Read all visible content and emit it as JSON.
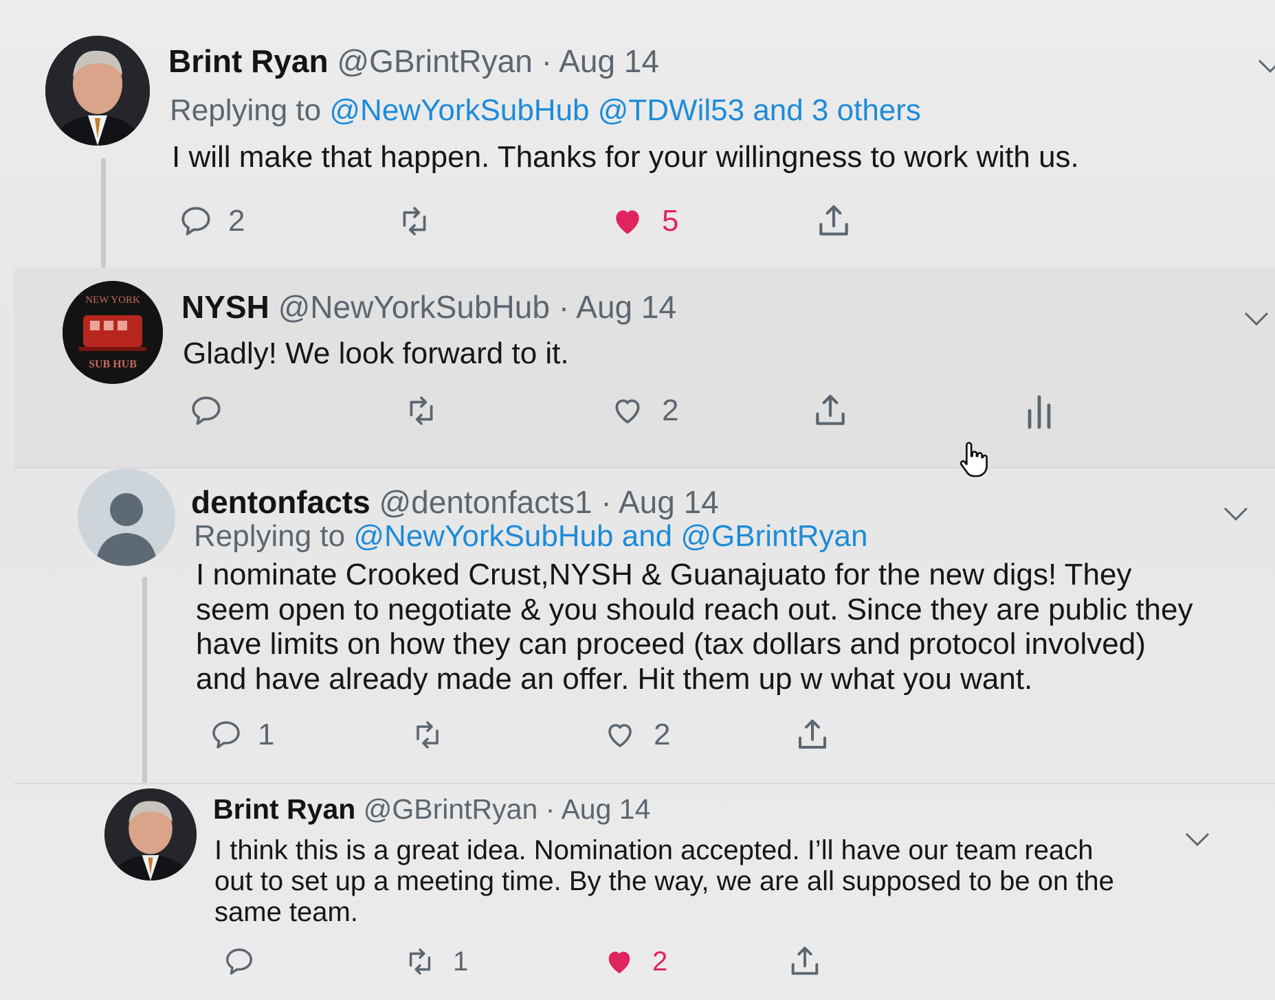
{
  "colors": {
    "link": "#1d8bd8",
    "muted": "#5b6670",
    "like_active": "#e0245e"
  },
  "tweets": [
    {
      "name": "Brint Ryan",
      "handle": "@GBrintRyan",
      "separator": "·",
      "date": "Aug 14",
      "reply_prefix": "Replying to",
      "reply_links": [
        "@NewYorkSubHub",
        "@TDWil53",
        "and 3 others"
      ],
      "text": "I will make that happen.  Thanks for your willingness to work with us.",
      "replies": "2",
      "retweets": "",
      "likes": "5",
      "liked": true
    },
    {
      "name": "NYSH",
      "handle": "@NewYorkSubHub",
      "separator": "·",
      "date": "Aug 14",
      "text": "Gladly! We look forward to it.",
      "replies": "",
      "retweets": "",
      "likes": "2",
      "liked": false,
      "avatar_text_top": "NEW YORK",
      "avatar_text_bottom": "SUB HUB"
    },
    {
      "name": "dentonfacts",
      "handle": "@dentonfacts1",
      "separator": "·",
      "date": "Aug 14",
      "reply_prefix": "Replying to",
      "reply_links": [
        "@NewYorkSubHub",
        "and",
        "@GBrintRyan"
      ],
      "text_lines": [
        "I nominate Crooked Crust,NYSH & Guanajuato for the new digs! They",
        "seem open to negotiate & you should reach out. Since they are public they",
        "have limits on how they can proceed (tax dollars and protocol involved)",
        "and have already made an offer. Hit them up w what you want."
      ],
      "replies": "1",
      "retweets": "",
      "likes": "2",
      "liked": false
    },
    {
      "name": "Brint Ryan",
      "handle": "@GBrintRyan",
      "separator": "·",
      "date": "Aug 14",
      "text_lines": [
        "I think this is a great idea.  Nomination accepted.  I’ll have our team reach",
        "out to set up a meeting time.  By the way, we are all supposed to be on the",
        "same team."
      ],
      "replies": "",
      "retweets": "1",
      "likes": "2",
      "liked": true
    }
  ]
}
